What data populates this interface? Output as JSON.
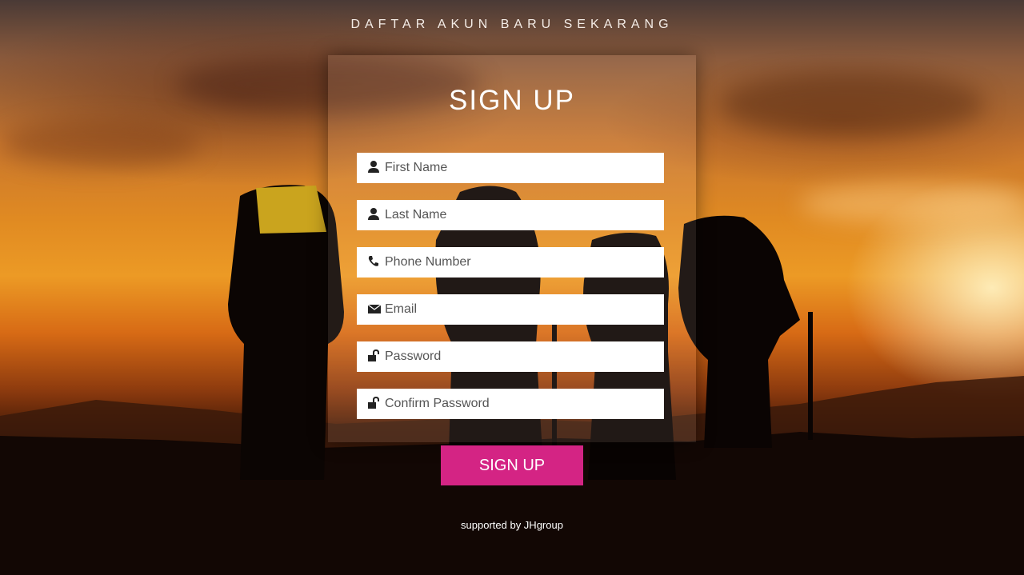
{
  "header": {
    "tagline": "DAFTAR AKUN BARU SEKARANG"
  },
  "form": {
    "title": "SIGN UP",
    "fields": [
      {
        "name": "first-name",
        "icon": "user-icon",
        "placeholder": "First Name",
        "value": ""
      },
      {
        "name": "last-name",
        "icon": "user-icon",
        "placeholder": "Last Name",
        "value": ""
      },
      {
        "name": "phone-number",
        "icon": "phone-icon",
        "placeholder": "Phone Number",
        "value": ""
      },
      {
        "name": "email",
        "icon": "envelope-icon",
        "placeholder": "Email",
        "value": ""
      },
      {
        "name": "password",
        "icon": "unlock-icon",
        "placeholder": "Password",
        "value": ""
      },
      {
        "name": "confirm-password",
        "icon": "unlock-icon",
        "placeholder": "Confirm Password",
        "value": ""
      }
    ],
    "submit_label": "SIGN UP"
  },
  "footer": {
    "text": "supported by JHgroup"
  },
  "colors": {
    "accent": "#d42484",
    "field_background": "#ffffff",
    "text_light": "#ffffff"
  }
}
